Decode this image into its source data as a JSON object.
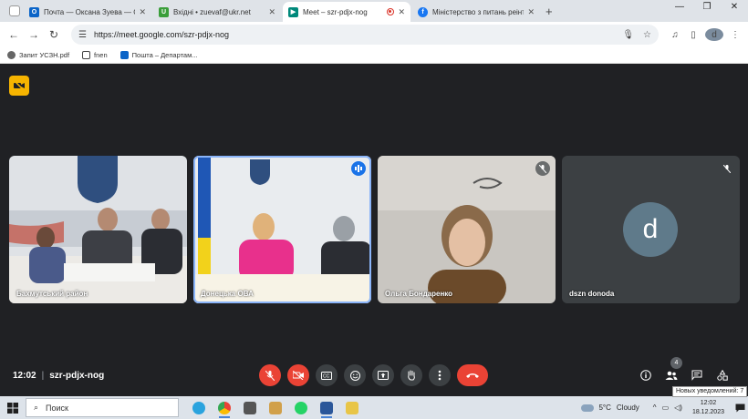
{
  "browser": {
    "tabs": [
      {
        "title": "Почта — Оксана Зуева — Out",
        "icon": "outlook-icon",
        "color": "#0a64c8",
        "active": false
      },
      {
        "title": "Вхідні • zuevaf@ukr.net",
        "icon": "ukrnet-icon",
        "color": "#3a9e3a",
        "active": false
      },
      {
        "title": "Meet – szr-pdjx-nog",
        "icon": "meet-icon",
        "color": "#00897b",
        "active": true
      },
      {
        "title": "Міністерство з питань реінте",
        "icon": "facebook-icon",
        "color": "#1877f2",
        "active": false
      }
    ],
    "new_tab": "+",
    "url": "https://meet.google.com/szr-pdjx-nog",
    "profile_letter": "d",
    "bookmarks": [
      {
        "label": "Запит УСЗН.pdf",
        "icon": "globe-icon"
      },
      {
        "label": "fnen",
        "icon": "folder-icon"
      },
      {
        "label": "Пошта – Департам...",
        "icon": "outlook-icon"
      }
    ]
  },
  "meet": {
    "participants": [
      {
        "name": "Бахмутський район",
        "muted": false,
        "speaking": false,
        "avatar": ""
      },
      {
        "name": "Донецька ОВА",
        "muted": false,
        "speaking": true,
        "avatar": ""
      },
      {
        "name": "Ольга Бондаренко",
        "muted": true,
        "speaking": false,
        "avatar": ""
      },
      {
        "name": "dszn donoda",
        "muted": true,
        "speaking": false,
        "avatar": "d"
      }
    ],
    "time": "12:02",
    "meeting_code": "szr-pdjx-nog",
    "people_count": "4",
    "notification_tooltip": "Новых уведомлений: 7"
  },
  "taskbar": {
    "search_label": "Поиск",
    "weather_temp": "5°C",
    "weather_desc": "Cloudy",
    "time": "12:02",
    "date": "18.12.2023"
  },
  "colors": {
    "meet_bg": "#202124",
    "control_red": "#ea4335",
    "speaking_blue": "#1a73e8",
    "camoff_yellow": "#f6b400"
  }
}
